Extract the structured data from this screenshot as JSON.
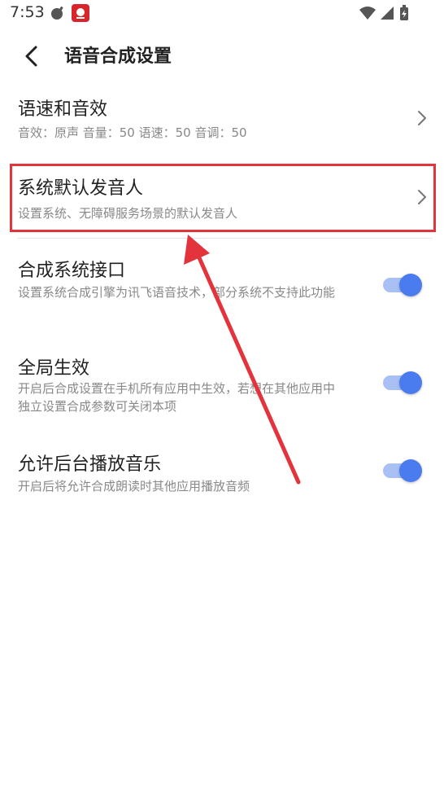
{
  "status_bar": {
    "time": "7:53"
  },
  "header": {
    "title": "语音合成设置",
    "back_icon": "chevron-left-icon"
  },
  "settings": [
    {
      "title": "语速和音效",
      "subtitle": "音效：原声 音量：50 语速：50 音调：50",
      "control": "chevron"
    },
    {
      "title": "系统默认发音人",
      "subtitle": "设置系统、无障碍服务场景的默认发音人",
      "control": "chevron",
      "highlighted": true
    },
    {
      "title": "合成系统接口",
      "subtitle": "设置系统合成引擎为讯飞语音技术，部分系统不支持此功能",
      "control": "toggle",
      "enabled": true
    },
    {
      "title": "全局生效",
      "subtitle": "开启后合成设置在手机所有应用中生效，若想在其他应用中独立设置合成参数可关闭本项",
      "control": "toggle",
      "enabled": true
    },
    {
      "title": "允许后台播放音乐",
      "subtitle": "开启后将允许合成朗读时其他应用播放音频",
      "control": "toggle",
      "enabled": true
    }
  ],
  "colors": {
    "highlight_border": "#e3333c",
    "toggle_on": "#4a7cf0",
    "arrow": "#e3333c"
  }
}
